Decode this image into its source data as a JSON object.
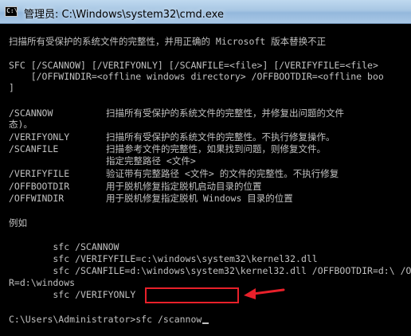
{
  "window": {
    "title": "管理员: C:\\Windows\\system32\\cmd.exe",
    "icon_label": "C:\\"
  },
  "console": {
    "intro": "扫描所有受保护的系统文件的完整性，并用正确的 Microsoft 版本替换不正",
    "syntax": [
      "SFC [/SCANNOW] [/VERIFYONLY] [/SCANFILE=<file>] [/VERIFYFILE=<file>",
      "    [/OFFWINDIR=<offline windows directory> /OFFBOOTDIR=<offline boo",
      "]"
    ],
    "options": [
      {
        "name": "/SCANNOW",
        "desc": "扫描所有受保护的系统文件的完整性，并修复出问题的文件"
      },
      {
        "name": "",
        "desc": "",
        "wrap": "态)。"
      },
      {
        "name": "/VERIFYONLY",
        "desc": "扫描所有受保护的系统文件的完整性。不执行修复操作。"
      },
      {
        "name": "/SCANFILE",
        "desc": "扫描参考文件的完整性，如果找到问题，则修复文件。"
      },
      {
        "name": "",
        "desc": "指定完整路径 <文件>"
      },
      {
        "name": "/VERIFYFILE",
        "desc": "验证带有完整路径 <文件> 的文件的完整性。不执行修复"
      },
      {
        "name": "/OFFBOOTDIR",
        "desc": "用于脱机修复指定脱机启动目录的位置"
      },
      {
        "name": "/OFFWINDIR",
        "desc": "用于脱机修复指定脱机 Windows 目录的位置"
      }
    ],
    "example_heading": "例如",
    "examples": [
      "        sfc /SCANNOW",
      "        sfc /VERIFYFILE=c:\\windows\\system32\\kernel32.dll",
      "        sfc /SCANFILE=d:\\windows\\system32\\kernel32.dll /OFFBOOTDIR=d:\\ /OFFWINDI",
      "R=d:\\windows",
      "        sfc /VERIFYONLY"
    ],
    "prompt": "C:\\Users\\Administrator>",
    "command": "sfc /scannow"
  },
  "colors": {
    "console_text": "#c0c0c0",
    "console_bg": "#000000",
    "annotation": "#e8202a"
  }
}
